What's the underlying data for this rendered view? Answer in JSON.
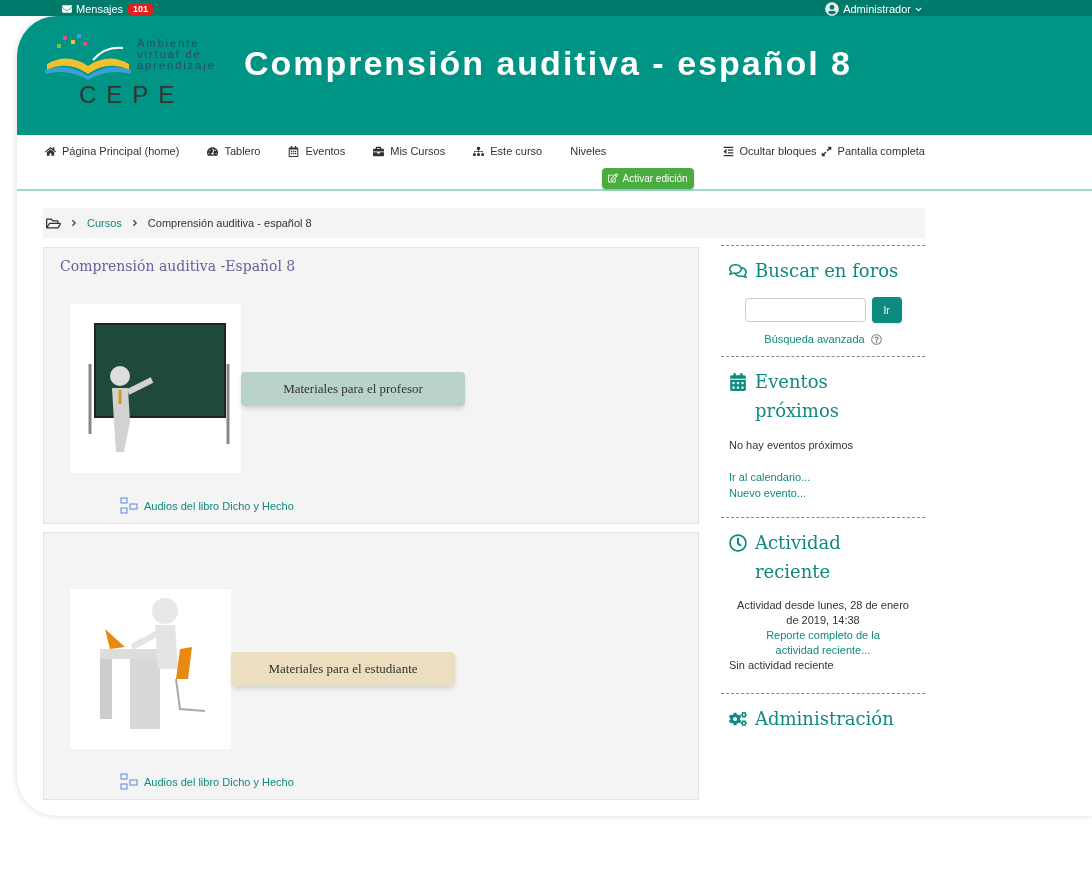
{
  "top_bar": {
    "messages_label": "Mensajes",
    "messages_count": "101",
    "user": "Administrador"
  },
  "header": {
    "logo_lines": [
      "Ambiente",
      "virtual de",
      "aprendizaje"
    ],
    "logo_acronym": "CEPE",
    "title": "Comprensión auditiva - español 8"
  },
  "nav": {
    "items": [
      {
        "label": "Página Principal (home)"
      },
      {
        "label": "Tablero"
      },
      {
        "label": "Eventos"
      },
      {
        "label": "Mis Cursos"
      },
      {
        "label": "Este curso"
      },
      {
        "label": "Niveles"
      }
    ],
    "right_items": [
      {
        "label": "Ocultar bloques"
      },
      {
        "label": "Pantalla completa"
      }
    ],
    "edit_button": "Activar edición"
  },
  "breadcrumb": [
    "Cursos",
    "Comprensión auditiva - español 8"
  ],
  "sections": [
    {
      "title": "Comprensión auditiva -Español 8",
      "kind": "teacher",
      "banner": "Materiales para el profesor",
      "link": "Audios del libro Dicho y Hecho"
    },
    {
      "kind": "student",
      "banner": "Materiales para el estudiante",
      "link": "Audios del libro Dicho y Hecho"
    }
  ],
  "blocks": [
    {
      "kind": "search",
      "title": "Buscar en foros",
      "button": "Ir",
      "link": "Búsqueda avanzada"
    },
    {
      "kind": "events",
      "title": "Eventos próximos",
      "text": "No hay eventos próximos",
      "links": [
        "Ir al calendario...",
        "Nuevo evento..."
      ]
    },
    {
      "kind": "recent",
      "title": "Actividad reciente",
      "since": "Actividad desde lunes, 28 de enero de 2019, 14:38",
      "report_link": "Reporte completo de la actividad reciente...",
      "empty": "Sin actividad reciente"
    },
    {
      "kind": "admin",
      "title": "Administración"
    }
  ]
}
